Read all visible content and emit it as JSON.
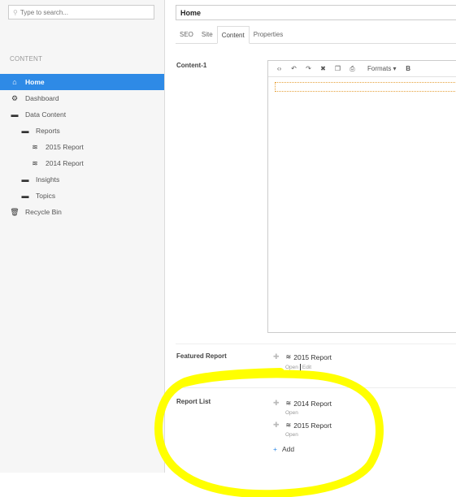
{
  "search": {
    "placeholder": "Type to search...",
    "icon": "search-icon"
  },
  "tree": {
    "section_title": "CONTENT",
    "items": [
      {
        "label": "Home",
        "icon": "home-icon",
        "active": true
      },
      {
        "label": "Dashboard",
        "icon": "dashboard-icon"
      },
      {
        "label": "Data Content",
        "icon": "folder-icon"
      },
      {
        "label": "Reports",
        "icon": "folder-icon"
      },
      {
        "label": "2015 Report",
        "icon": "report-icon"
      },
      {
        "label": "2014 Report",
        "icon": "report-icon"
      },
      {
        "label": "Insights",
        "icon": "folder-icon"
      },
      {
        "label": "Topics",
        "icon": "folder-icon"
      },
      {
        "label": "Recycle Bin",
        "icon": "trash-icon"
      }
    ]
  },
  "header": {
    "title": "Home"
  },
  "tabs": [
    {
      "label": "SEO"
    },
    {
      "label": "Site"
    },
    {
      "label": "Content",
      "active": true
    },
    {
      "label": "Properties"
    }
  ],
  "properties": {
    "content1": {
      "label": "Content-1"
    },
    "featured": {
      "label": "Featured Report",
      "items": [
        {
          "name": "2015 Report",
          "open": "Open",
          "edit": "Edit"
        }
      ]
    },
    "report_list": {
      "label": "Report List",
      "items": [
        {
          "name": "2014 Report",
          "open": "Open"
        },
        {
          "name": "2015 Report",
          "open": "Open"
        }
      ],
      "add_label": "Add"
    }
  },
  "editor_toolbar": {
    "formats_label": "Formats ▾",
    "bold_label": "B"
  },
  "colors": {
    "accent": "#2e8ae6",
    "highlight": "#ffff00",
    "placeholder_border": "#e6a23c"
  }
}
